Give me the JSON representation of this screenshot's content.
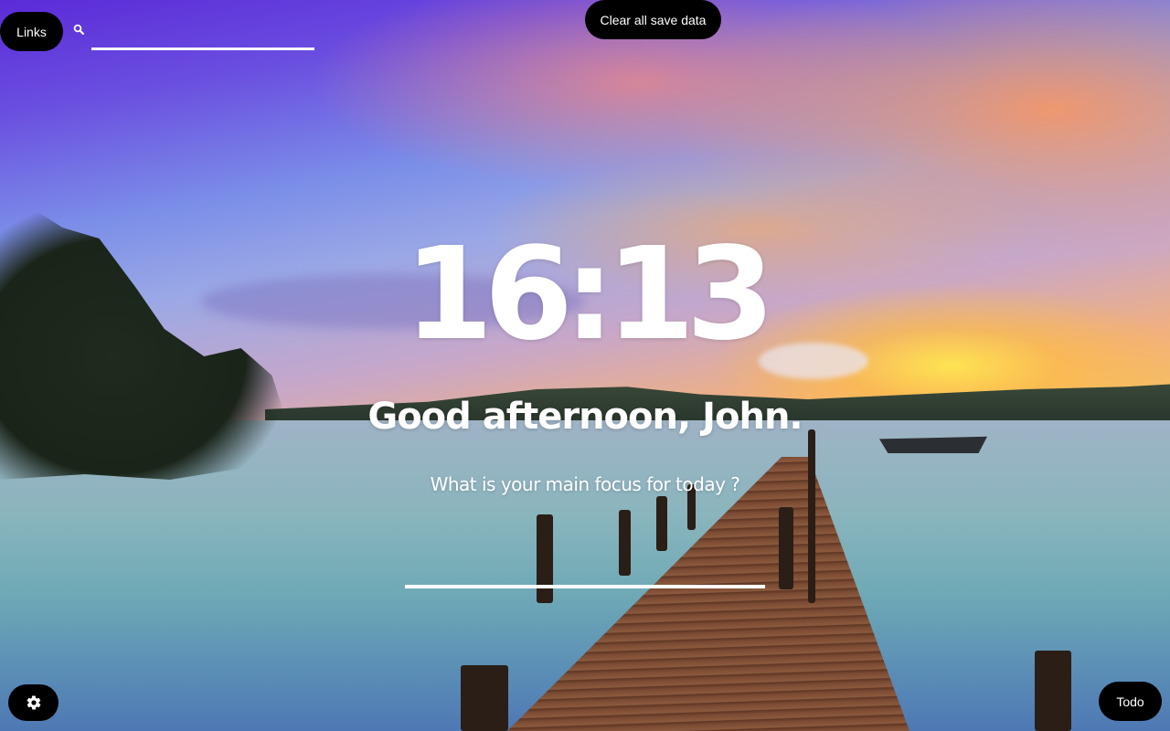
{
  "topbar": {
    "links_label": "Links",
    "search": {
      "value": "",
      "placeholder": "",
      "icon": "search-icon"
    },
    "clear_label": "Clear all save data"
  },
  "main": {
    "clock": "16:13",
    "greeting": "Good afternoon, John.",
    "focus_question": "What is your main focus for today ?",
    "focus_input": {
      "value": "",
      "placeholder": ""
    }
  },
  "bottombar": {
    "settings_icon": "gear-icon",
    "todo_label": "Todo"
  },
  "colors": {
    "button_bg": "#000000",
    "text": "#ffffff",
    "underline": "#ffffff"
  }
}
